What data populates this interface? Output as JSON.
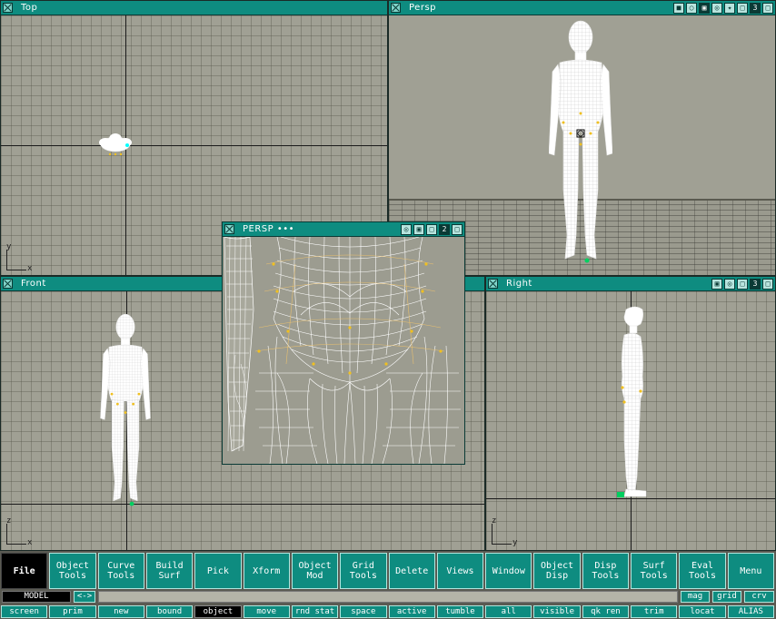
{
  "viewports": {
    "top": {
      "title": "Top"
    },
    "persp": {
      "title": "Persp",
      "number": "3"
    },
    "front": {
      "title": "Front"
    },
    "right": {
      "title": "Right",
      "number": "3"
    },
    "persp2": {
      "title": "PERSP •••",
      "number": "2"
    }
  },
  "axes": {
    "x": "x",
    "y": "y",
    "z": "z"
  },
  "menu": [
    {
      "label": "File"
    },
    {
      "label": "Object\nTools"
    },
    {
      "label": "Curve\nTools"
    },
    {
      "label": "Build\nSurf"
    },
    {
      "label": "Pick"
    },
    {
      "label": "Xform"
    },
    {
      "label": "Object\nMod"
    },
    {
      "label": "Grid\nTools"
    },
    {
      "label": "Delete"
    },
    {
      "label": "Views"
    },
    {
      "label": "Window"
    },
    {
      "label": "Object\nDisp"
    },
    {
      "label": "Disp\nTools"
    },
    {
      "label": "Surf\nTools"
    },
    {
      "label": "Eval\nTools"
    },
    {
      "label": "Menu"
    }
  ],
  "status": {
    "mode": "MODEL",
    "arrows": "<->",
    "prompt": "",
    "mag": "mag",
    "grid": "grid",
    "crv": "crv"
  },
  "bottom": [
    "screen",
    "prim",
    "new",
    "bound",
    "object",
    "move",
    "rnd stat",
    "space",
    "active",
    "tumble",
    "all",
    "visible",
    "qk ren",
    "trim",
    "locat",
    "ALIAS"
  ],
  "bottom_selected": "object",
  "colors": {
    "titlebar": "#0e8c80",
    "viewport_bg": "#a0a094",
    "wire": "#ffffff",
    "cv": "#f0c020"
  }
}
